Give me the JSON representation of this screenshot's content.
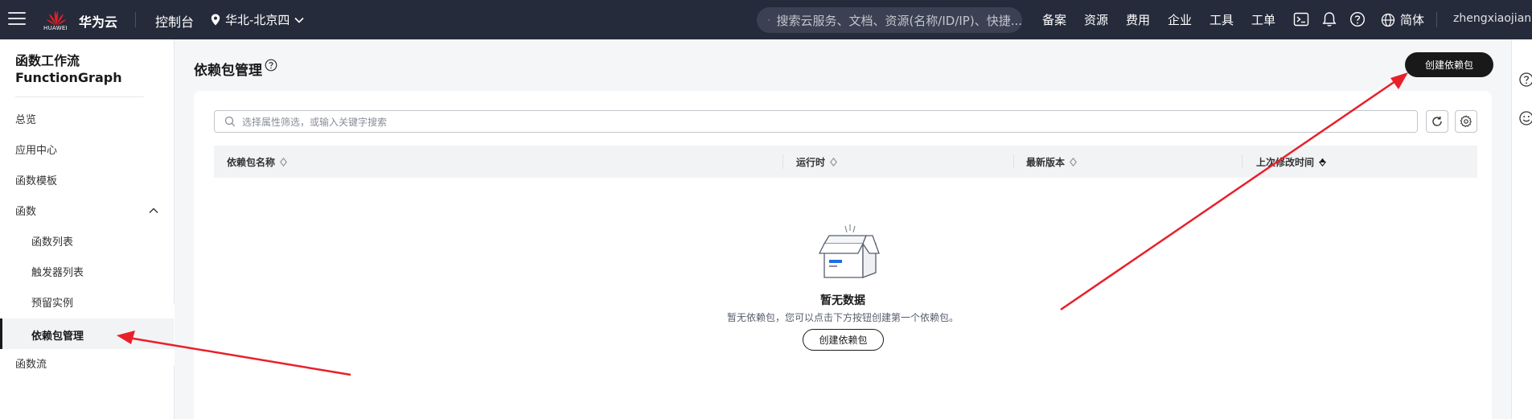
{
  "topbar": {
    "brand": "华为云",
    "logo_text": "HUAWEI",
    "console": "控制台",
    "region": "华北-北京四",
    "search_placeholder": "搜索云服务、文档、资源(名称/ID/IP)、快捷...",
    "nav": [
      "备案",
      "资源",
      "费用",
      "企业",
      "工具",
      "工单"
    ],
    "language": "简体",
    "username": "zhengxiaojian"
  },
  "sidebar": {
    "title_line1": "函数工作流",
    "title_line2": "FunctionGraph",
    "items": {
      "overview": "总览",
      "app_center": "应用中心",
      "templates": "函数模板",
      "functions": "函数",
      "function_list": "函数列表",
      "trigger_list": "触发器列表",
      "reserved": "预留实例",
      "dependencies": "依赖包管理",
      "flow": "函数流"
    }
  },
  "main": {
    "page_title": "依赖包管理",
    "create_button": "创建依赖包",
    "filter_placeholder": "选择属性筛选，或输入关键字搜索",
    "columns": [
      "依赖包名称",
      "运行时",
      "最新版本",
      "上次修改时间"
    ],
    "empty_title": "暂无数据",
    "empty_desc": "暂无依赖包，您可以点击下方按钮创建第一个依赖包。",
    "empty_button": "创建依赖包"
  },
  "icons": {
    "menu": "hamburger-icon",
    "location": "location-pin-icon",
    "search": "search-icon",
    "terminal": "terminal-icon",
    "bell": "bell-icon",
    "help": "help-icon",
    "globe": "globe-icon",
    "refresh": "refresh-icon",
    "settings": "gear-icon",
    "sort": "sort-icon",
    "box": "empty-box-icon",
    "smile": "smile-icon"
  },
  "colors": {
    "topbar_bg": "#252b3a",
    "primary_button": "#191919",
    "annotation_arrow": "#e8202a",
    "main_bg": "#f4f6f8"
  }
}
